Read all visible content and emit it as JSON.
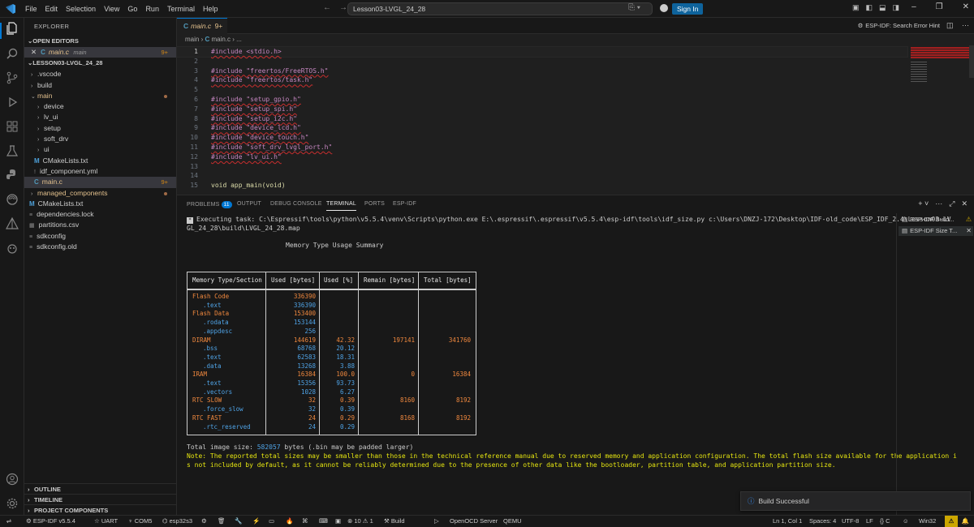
{
  "titlebar": {
    "menu": [
      "File",
      "Edit",
      "Selection",
      "View",
      "Go",
      "Run",
      "Terminal",
      "Help"
    ],
    "search_text": "Lesson03-LVGL_24_28",
    "signin_label": "Sign In"
  },
  "sidebar": {
    "header": "EXPLORER",
    "open_editors_label": "OPEN EDITORS",
    "open_editor": {
      "name": "main.c",
      "folder": "main",
      "badge": "9+"
    },
    "project_label": "LESSON03-LVGL_24_28",
    "items": [
      {
        "label": ".vscode",
        "kind": "folder"
      },
      {
        "label": "build",
        "kind": "folder"
      },
      {
        "label": "main",
        "kind": "folder-open"
      },
      {
        "label": "device",
        "kind": "folder"
      },
      {
        "label": "lv_ui",
        "kind": "folder"
      },
      {
        "label": "setup",
        "kind": "folder"
      },
      {
        "label": "soft_drv",
        "kind": "folder"
      },
      {
        "label": "ui",
        "kind": "folder"
      },
      {
        "label": "CMakeLists.txt",
        "kind": "cmake"
      },
      {
        "label": "idf_component.yml",
        "kind": "file"
      },
      {
        "label": "main.c",
        "kind": "c",
        "badge": "9+"
      },
      {
        "label": "managed_components",
        "kind": "folder"
      },
      {
        "label": "CMakeLists.txt",
        "kind": "cmake"
      },
      {
        "label": "dependencies.lock",
        "kind": "file"
      },
      {
        "label": "partitions.csv",
        "kind": "file"
      },
      {
        "label": "sdkconfig",
        "kind": "file"
      },
      {
        "label": "sdkconfig.old",
        "kind": "file"
      }
    ],
    "outline_label": "OUTLINE",
    "timeline_label": "TIMELINE",
    "project_components_label": "PROJECT COMPONENTS"
  },
  "editor": {
    "tab_label": "main.c",
    "tab_badge": "9+",
    "hint": "ESP-IDF: Search Error Hint",
    "breadcrumb_folder": "main",
    "breadcrumb_file": "main.c",
    "breadcrumb_more": "...",
    "lines": [
      {
        "n": "1",
        "text": "#include <stdio.h>"
      },
      {
        "n": "2",
        "text": ""
      },
      {
        "n": "3",
        "text": "#include \"freertos/FreeRTOS.h\""
      },
      {
        "n": "4",
        "text": "#include \"freertos/task.h\""
      },
      {
        "n": "5",
        "text": ""
      },
      {
        "n": "6",
        "text": "#include \"setup_gpio.h\""
      },
      {
        "n": "7",
        "text": "#include \"setup_spi.h\""
      },
      {
        "n": "8",
        "text": "#include \"setup_i2c.h\""
      },
      {
        "n": "9",
        "text": "#include \"device_lcd.h\""
      },
      {
        "n": "10",
        "text": "#include \"device_touch.h\""
      },
      {
        "n": "11",
        "text": "#include \"soft_drv_lvgl_port.h\""
      },
      {
        "n": "12",
        "text": "#include \"lv_ui.h\""
      },
      {
        "n": "13",
        "text": ""
      },
      {
        "n": "14",
        "text": ""
      },
      {
        "n": "15",
        "text": "void app_main(void)"
      }
    ]
  },
  "panel": {
    "tabs": [
      "PROBLEMS",
      "OUTPUT",
      "DEBUG CONSOLE",
      "TERMINAL",
      "PORTS",
      "ESP-IDF"
    ],
    "problems_count": "11",
    "active_tab": "TERMINAL",
    "terminals": [
      {
        "label": "ESP-IDF Build...",
        "status": "warning"
      },
      {
        "label": "ESP-IDF Size T...",
        "status": "active"
      }
    ],
    "task_line1": "Executing task: C:\\Espressif\\tools\\python\\v5.5.4\\venv\\Scripts\\python.exe E:\\.espressif\\.espressif\\v5.5.4\\esp-idf\\tools\\idf_size.py c:\\Users\\DNZJ-172\\Desktop\\IDF-old_code\\ESP_IDF_2.4\\Lesson03-LV",
    "task_line2": "GL_24_28\\build\\LVGL_24_28.map",
    "table_title": "Memory Type Usage Summary",
    "table_headers": [
      "Memory Type/Section",
      "Used [bytes]",
      "Used [%]",
      "Remain [bytes]",
      "Total [bytes]"
    ],
    "table_rows": [
      {
        "name": "Flash Code",
        "sub": false,
        "used": "336390",
        "pct": "",
        "remain": "",
        "total": ""
      },
      {
        "name": ".text",
        "sub": true,
        "used": "336390",
        "pct": "",
        "remain": "",
        "total": ""
      },
      {
        "name": "Flash Data",
        "sub": false,
        "used": "153400",
        "pct": "",
        "remain": "",
        "total": ""
      },
      {
        "name": ".rodata",
        "sub": true,
        "used": "153144",
        "pct": "",
        "remain": "",
        "total": ""
      },
      {
        "name": ".appdesc",
        "sub": true,
        "used": "256",
        "pct": "",
        "remain": "",
        "total": ""
      },
      {
        "name": "DIRAM",
        "sub": false,
        "used": "144619",
        "pct": "42.32",
        "remain": "197141",
        "total": "341760"
      },
      {
        "name": ".bss",
        "sub": true,
        "used": "68768",
        "pct": "20.12",
        "remain": "",
        "total": ""
      },
      {
        "name": ".text",
        "sub": true,
        "used": "62583",
        "pct": "18.31",
        "remain": "",
        "total": ""
      },
      {
        "name": ".data",
        "sub": true,
        "used": "13268",
        "pct": "3.88",
        "remain": "",
        "total": ""
      },
      {
        "name": "IRAM",
        "sub": false,
        "used": "16384",
        "pct": "100.0",
        "remain": "0",
        "total": "16384"
      },
      {
        "name": ".text",
        "sub": true,
        "used": "15356",
        "pct": "93.73",
        "remain": "",
        "total": ""
      },
      {
        "name": ".vectors",
        "sub": true,
        "used": "1028",
        "pct": "6.27",
        "remain": "",
        "total": ""
      },
      {
        "name": "RTC SLOW",
        "sub": false,
        "used": "32",
        "pct": "0.39",
        "remain": "8160",
        "total": "8192"
      },
      {
        "name": ".force_slow",
        "sub": true,
        "used": "32",
        "pct": "0.39",
        "remain": "",
        "total": ""
      },
      {
        "name": "RTC FAST",
        "sub": false,
        "used": "24",
        "pct": "0.29",
        "remain": "8168",
        "total": "8192"
      },
      {
        "name": ".rtc_reserved",
        "sub": true,
        "used": "24",
        "pct": "0.29",
        "remain": "",
        "total": ""
      }
    ],
    "total_prefix": "Total image size: ",
    "total_value": "582057",
    "total_suffix": " bytes (.bin may be padded larger)",
    "note_line1": "Note: The reported total sizes may be smaller than those in the technical reference manual due to reserved memory and application configuration. The total flash size available for the application i",
    "note_line2": "s not included by default, as it cannot be reliably determined due to the presence of other data like the bootloader, partition table, and application partition size."
  },
  "notification": {
    "text": "Build Successful"
  },
  "statusbar": {
    "esp_idf": "ESP-IDF v5.5.4",
    "uart": "UART",
    "port": "COM5",
    "target": "esp32s3",
    "errors": "10",
    "warnings": "1",
    "build": "Build",
    "openocd": "OpenOCD Server",
    "qemu": "QEMU",
    "position": "Ln 1, Col 1",
    "spaces": "Spaces: 4",
    "encoding": "UTF-8",
    "eol": "LF",
    "language": "C",
    "platform": "Win32"
  },
  "colors": {
    "accent": "#0078d4",
    "orange": "#f0883e",
    "blue": "#4fa3e6",
    "warning": "#cca700"
  }
}
